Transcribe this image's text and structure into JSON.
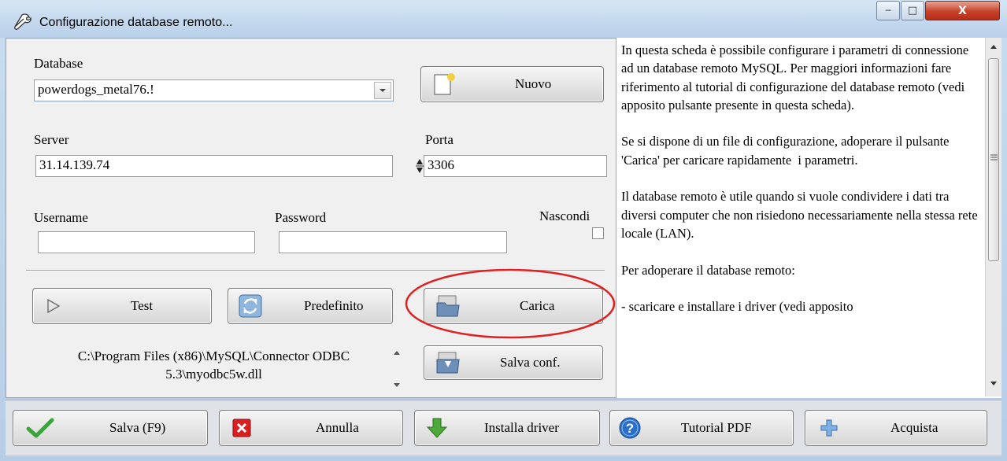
{
  "window": {
    "title": "Configurazione database remoto...",
    "controls": {
      "minimize_glyph": "─",
      "maximize_glyph": "□",
      "close_glyph": "X"
    }
  },
  "form": {
    "database": {
      "label": "Database",
      "value": "powerdogs_metal76.!"
    },
    "nuovo_label": "Nuovo",
    "server": {
      "label": "Server",
      "value": "31.14.139.74"
    },
    "porta": {
      "label": "Porta",
      "value": "3306"
    },
    "username": {
      "label": "Username",
      "value": ""
    },
    "password": {
      "label": "Password",
      "value": ""
    },
    "nascondi_label": "Nascondi"
  },
  "actions": {
    "test_label": "Test",
    "predefinito_label": "Predefinito",
    "carica_label": "Carica",
    "salva_conf_label": "Salva conf."
  },
  "driver_path": {
    "line1": "C:\\Program Files (x86)\\MySQL\\Connector ODBC",
    "line2": "5.3\\myodbc5w.dll"
  },
  "info_text": "In questa scheda è possibile configurare i parametri di connessione ad un database remoto MySQL. Per maggiori informazioni fare riferimento al tutorial di configurazione del database remoto (vedi apposito pulsante presente in questa scheda).\n\nSe si dispone di un file di configurazione, adoperare il pulsante 'Carica' per caricare rapidamente  i parametri.\n\nIl database remoto è utile quando si vuole condividere i dati tra diversi computer che non risiedono necessariamente nella stessa rete locale (LAN).\n\nPer adoperare il database remoto:\n\n- scaricare e installare i driver (vedi apposito",
  "bottom_bar": {
    "salva_label": "Salva (F9)",
    "annulla_label": "Annulla",
    "installa_label": "Installa driver",
    "tutorial_label": "Tutorial PDF",
    "acquista_label": "Acquista"
  },
  "colors": {
    "highlight_ellipse": "#e02020",
    "check_green": "#3aa53a",
    "cancel_red": "#d92020",
    "help_blue": "#2a6fc9"
  }
}
